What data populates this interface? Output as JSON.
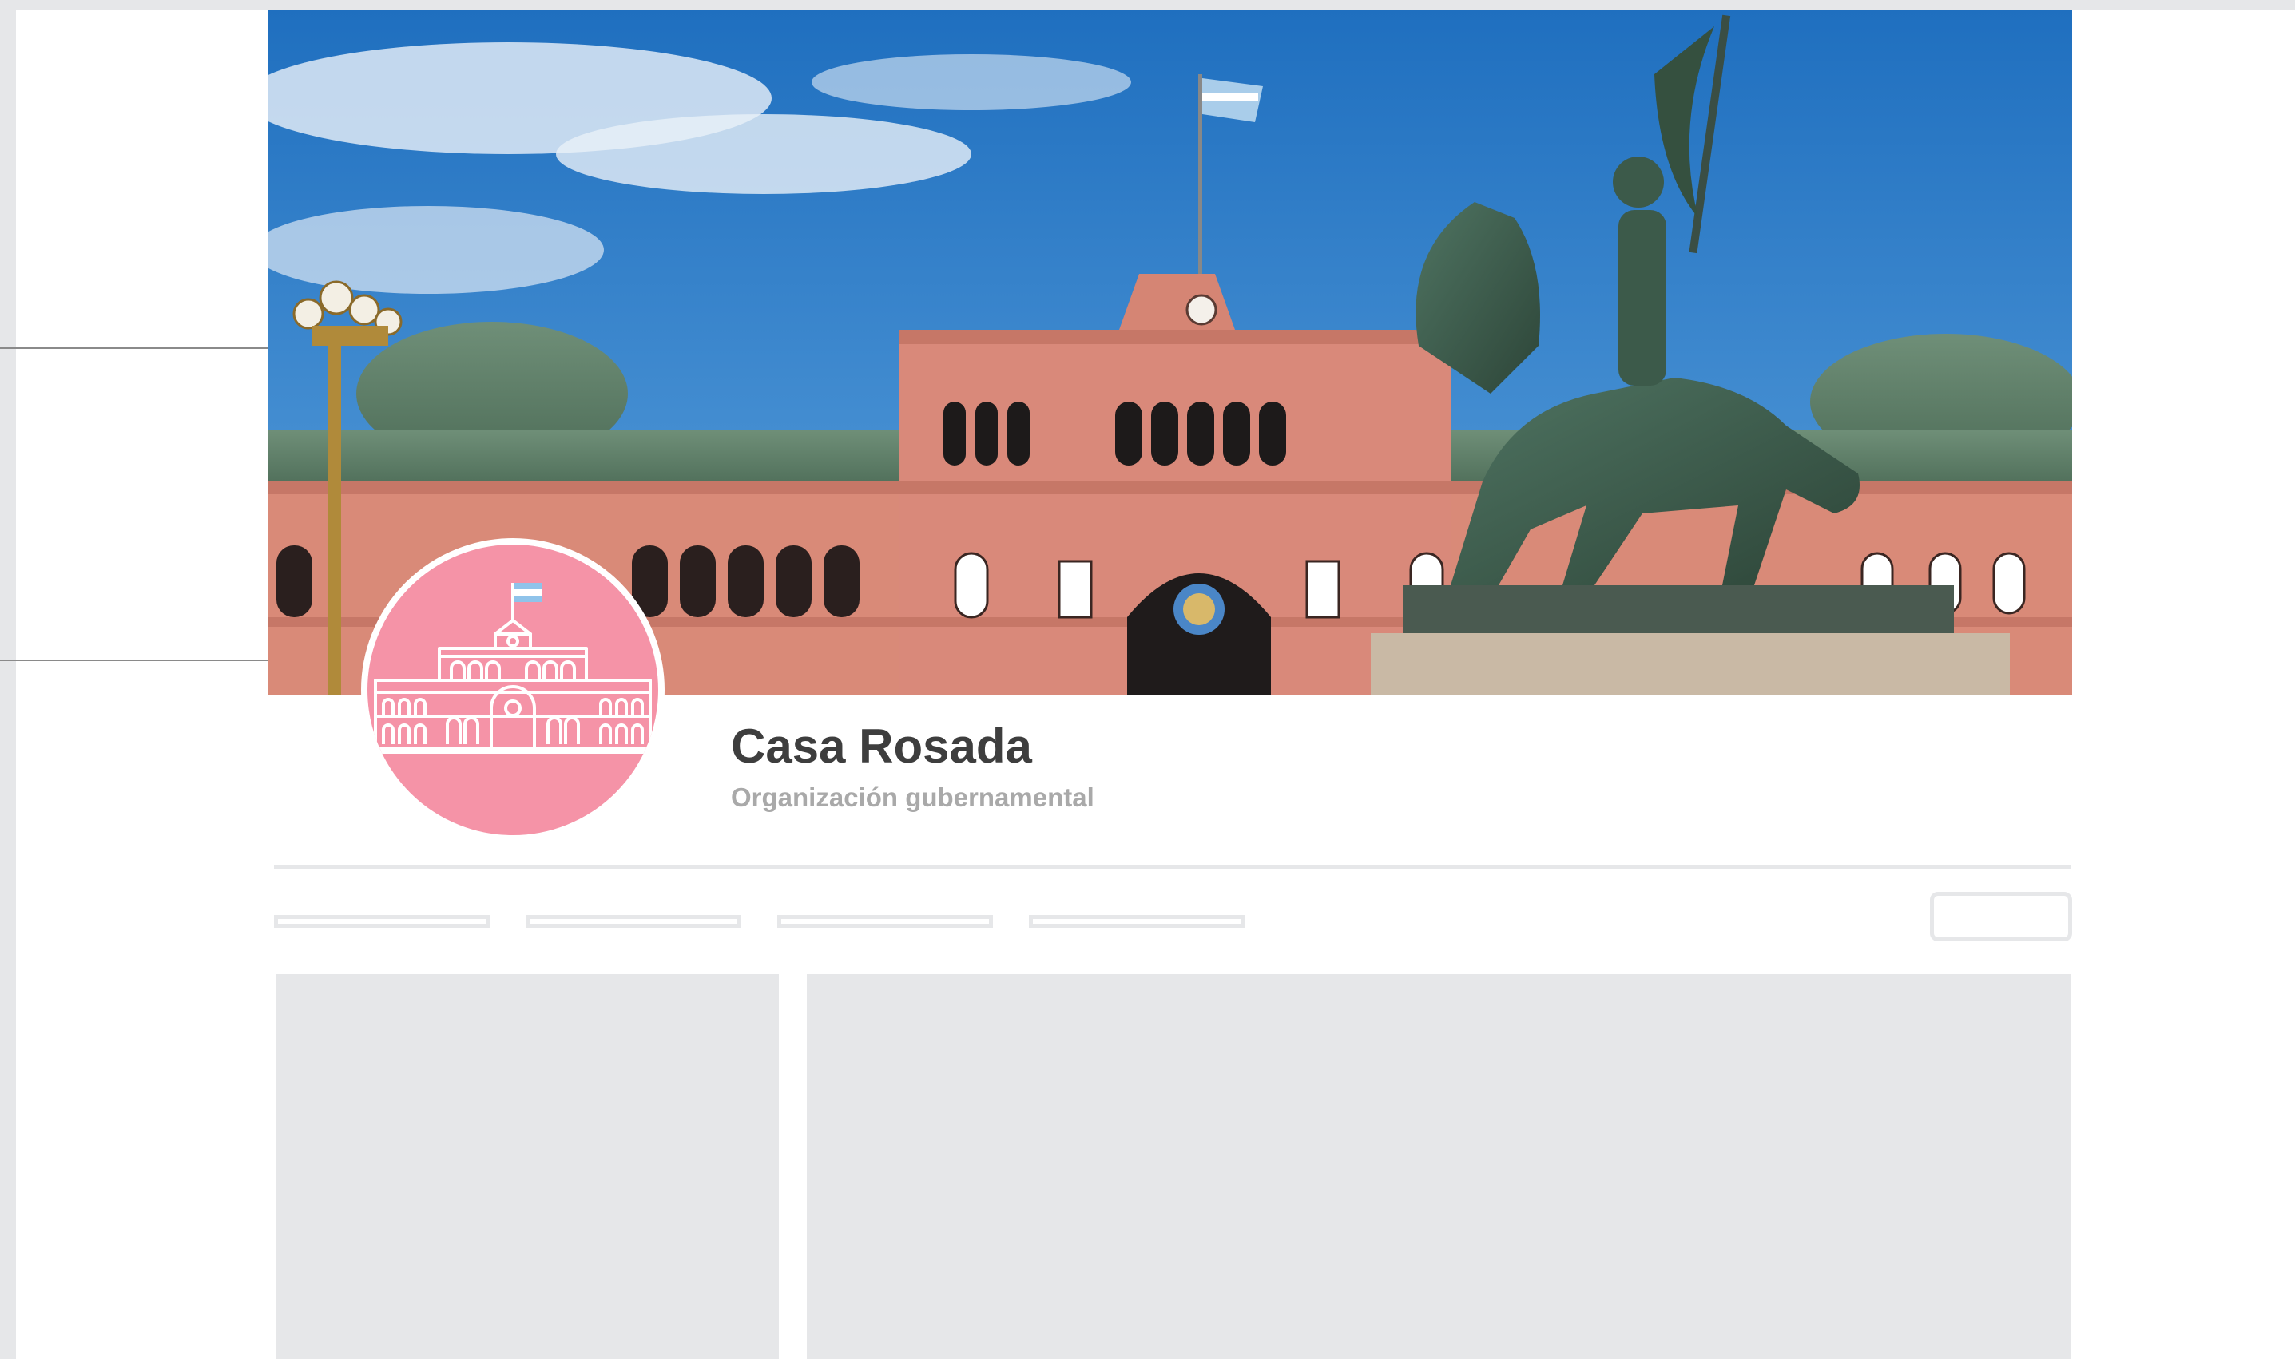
{
  "profile": {
    "name": "Casa Rosada",
    "category": "Organización gubernamental"
  },
  "cover": {
    "description_icon": "casa-rosada-photo"
  },
  "colors": {
    "avatar_bg": "#f593a7",
    "placeholder_gray": "#e6e7e9",
    "name_text": "#3e3e3e",
    "category_text": "#a9a9a9",
    "sky": "#2a7cc7",
    "facade": "#d98a78"
  },
  "tabs": [
    "",
    "",
    "",
    ""
  ]
}
